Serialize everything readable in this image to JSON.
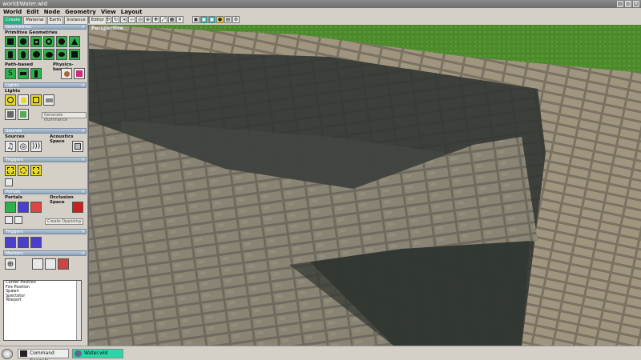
{
  "window": {
    "title": "world/Water.wld"
  },
  "menu": [
    "World",
    "Edit",
    "Node",
    "Geometry",
    "View",
    "Layout"
  ],
  "panel_tabs": [
    "Create",
    "Material",
    "Earth",
    "Instance",
    "Editor"
  ],
  "sections": {
    "geometries": "Geometries",
    "lights": "Lights",
    "sounds": "Sounds",
    "triggers_a": "Triggers",
    "portals": "Portals",
    "triggers_b": "Triggers",
    "markers": "Markers"
  },
  "labels": {
    "primitive_geometries": "Primitive Geometries",
    "path_based": "Path-based",
    "physics_based": "Physics-based",
    "lights": "Lights",
    "sources": "Sources",
    "acoustics_space": "Acoustics Space",
    "portals": "Portals",
    "occlusion_space": "Occlusion Space"
  },
  "buttons": {
    "generate_illuminance": "Generate Illuminance",
    "create_opposing": "Create Opposing"
  },
  "markers": [
    "Center Position",
    "Fire Position",
    "Spawn",
    "Spectator",
    "Teleport"
  ],
  "viewport": {
    "label": "Perspective"
  },
  "taskbar": {
    "items": [
      {
        "label": "Command Console"
      },
      {
        "label": "Water.wld"
      }
    ]
  },
  "colors": {
    "active_tab": "#23b27c",
    "active_task": "#28d6a8",
    "grass": "#4c8a2c",
    "water": "#2f3430"
  },
  "icons": {
    "viewport_icons": [
      "cursor-icon",
      "select-icon",
      "move-icon",
      "rotate-icon",
      "scale-icon",
      "snap-icon",
      "camera-icon",
      "zoom-icon",
      "view-icon",
      "light-toggle-icon",
      "sound-toggle-icon",
      "bulb-icon",
      "layers-icon",
      "settings-icon"
    ]
  }
}
